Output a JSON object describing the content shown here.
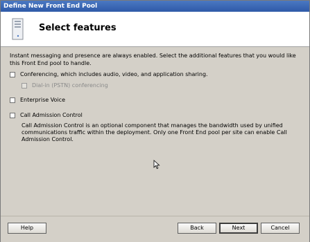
{
  "window": {
    "title": "Define New Front End Pool"
  },
  "header": {
    "title": "Select features",
    "icon": "server-icon"
  },
  "intro": "Instant messaging and presence are always enabled.  Select the additional features that you would like this Front End pool to handle.",
  "features": {
    "conferencing": {
      "label": "Conferencing, which includes audio, video, and application sharing.",
      "checked": false
    },
    "dialin": {
      "label": "Dial-in (PSTN) conferencing",
      "checked": false,
      "enabled": false
    },
    "enterprise_voice": {
      "label": "Enterprise Voice",
      "checked": false
    },
    "cac": {
      "label": "Call Admission Control",
      "checked": false,
      "description": "Call Admission Control is an optional component that manages the bandwidth used by unified communications traffic within the deployment.  Only one Front End pool per site can enable Call Admission Control."
    }
  },
  "buttons": {
    "help": "Help",
    "back": "Back",
    "next": "Next",
    "cancel": "Cancel"
  }
}
